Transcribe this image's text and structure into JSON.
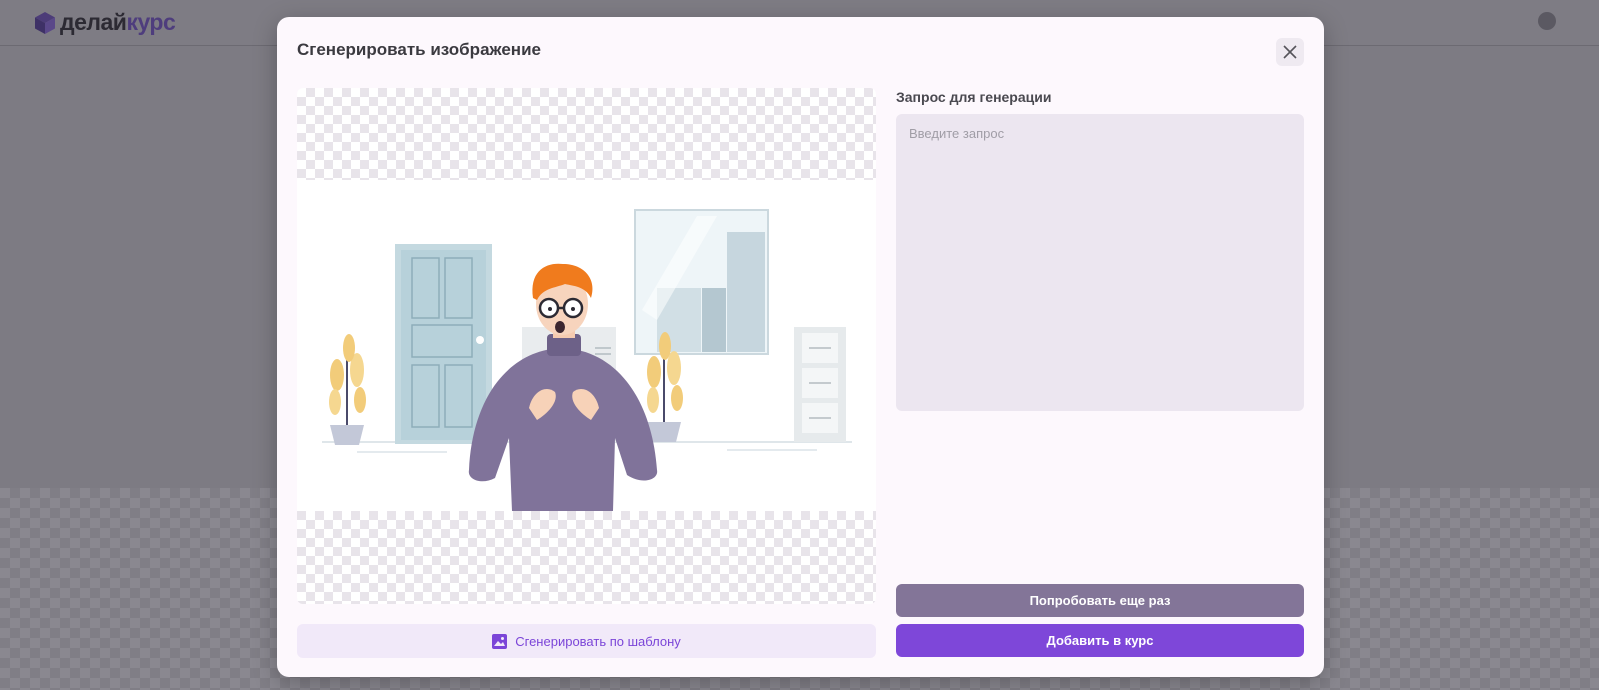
{
  "app": {
    "logo_part1": "делай",
    "logo_part2": "курс"
  },
  "modal": {
    "title": "Сгенерировать изображение",
    "template_button": "Сгенерировать по шаблону",
    "prompt_label": "Запрос для генерации",
    "prompt_placeholder": "Введите запрос",
    "prompt_value": "",
    "retry_button": "Попробовать еще раз",
    "add_button": "Добавить в курс"
  },
  "colors": {
    "accent": "#7e47d9",
    "secondary_button": "#837598",
    "template_button_bg": "#f1e9f9",
    "input_bg": "#ece6f0",
    "modal_bg": "#fdf8fd"
  },
  "icons": {
    "close": "close-icon",
    "template": "image-icon",
    "logo": "cube-logo-icon"
  }
}
